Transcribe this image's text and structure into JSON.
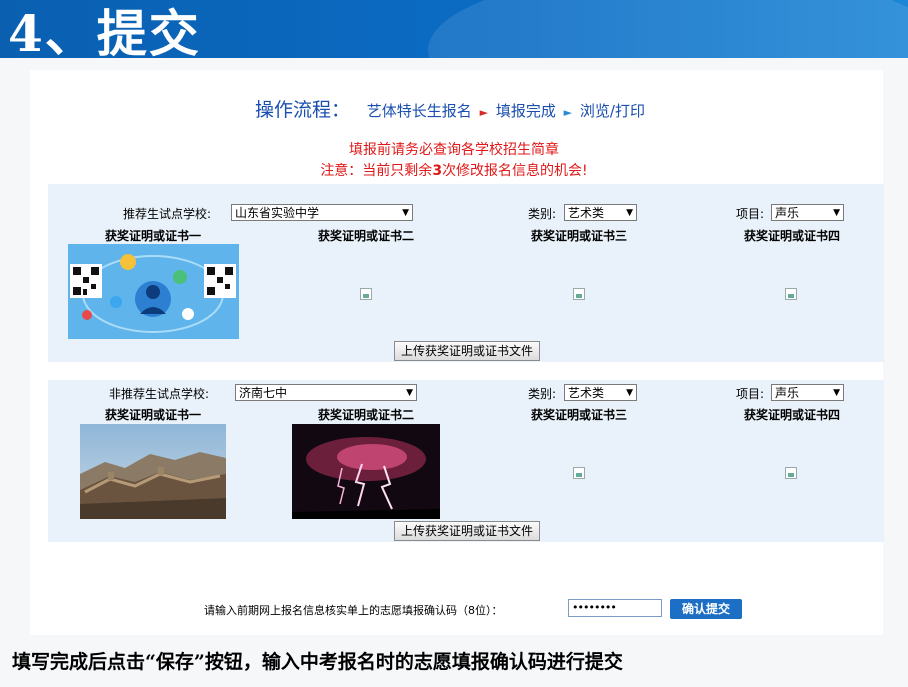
{
  "slide": {
    "title": "4、提交",
    "caption": "填写完成后点击“保存”按钮，输入中考报名时的志愿填报确认码进行提交"
  },
  "flow": {
    "label": "操作流程：",
    "steps": [
      "艺体特长生报名",
      "填报完成",
      "浏览/打印"
    ],
    "arrow": "►"
  },
  "notices": {
    "line1": "填报前请务必查询各学校招生简章",
    "line2_prefix": "注意：当前只剩余",
    "line2_count": "3",
    "line2_suffix": "次修改报名信息的机会!"
  },
  "recommended": {
    "school_label": "推荐生试点学校:",
    "school_value": "山东省实验中学",
    "category_label": "类别:",
    "category_value": "艺术类",
    "project_label": "项目:",
    "project_value": "声乐",
    "certs": [
      "获奖证明或证书一",
      "获奖证明或证书二",
      "获奖证明或证书三",
      "获奖证明或证书四"
    ],
    "upload_label": "上传获奖证明或证书文件"
  },
  "nonrecommended": {
    "school_label": "非推荐生试点学校:",
    "school_value": "济南七中",
    "category_label": "类别:",
    "category_value": "艺术类",
    "project_label": "项目:",
    "project_value": "声乐",
    "certs": [
      "获奖证明或证书一",
      "获奖证明或证书二",
      "获奖证明或证书三",
      "获奖证明或证书四"
    ],
    "upload_label": "上传获奖证明或证书文件"
  },
  "confirm": {
    "prompt": "请输入前期网上报名信息核实单上的志愿填报确认码（8位）：",
    "code_value": "••••••••",
    "submit_label": "确认提交"
  },
  "colors": {
    "banner": "#0b6cc4",
    "flow_link": "#1a4fb0",
    "notice": "#e01818",
    "block_bg": "#e9f2fa",
    "submit_bg": "#1c6fc4"
  }
}
